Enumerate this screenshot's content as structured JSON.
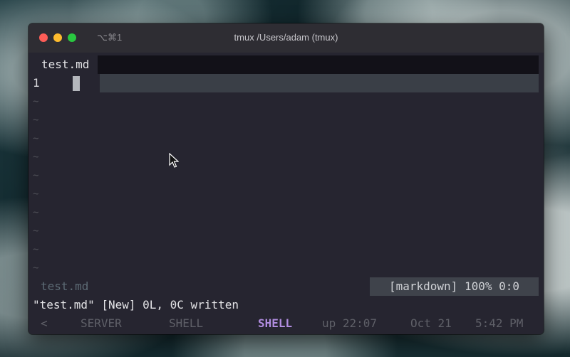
{
  "window": {
    "shortcut": "⌥⌘1",
    "title": "tmux /Users/adam (tmux)"
  },
  "vim": {
    "tab_active": "test.md",
    "line_number": "1",
    "tilde": "~",
    "status_file": "test.md",
    "status_right": "[markdown] 100% 0:0",
    "cmdline": "\"test.md\" [New] 0L, 0C written"
  },
  "tmux": {
    "prev_arrow": "<",
    "windows": [
      {
        "label": "SERVER",
        "active": false
      },
      {
        "label": "SHELL",
        "active": false
      },
      {
        "label": "SHELL",
        "active": true
      }
    ],
    "uptime": "up 22:07",
    "date": "Oct 21",
    "time": "5:42 PM",
    "active_color": "#b18de0"
  }
}
